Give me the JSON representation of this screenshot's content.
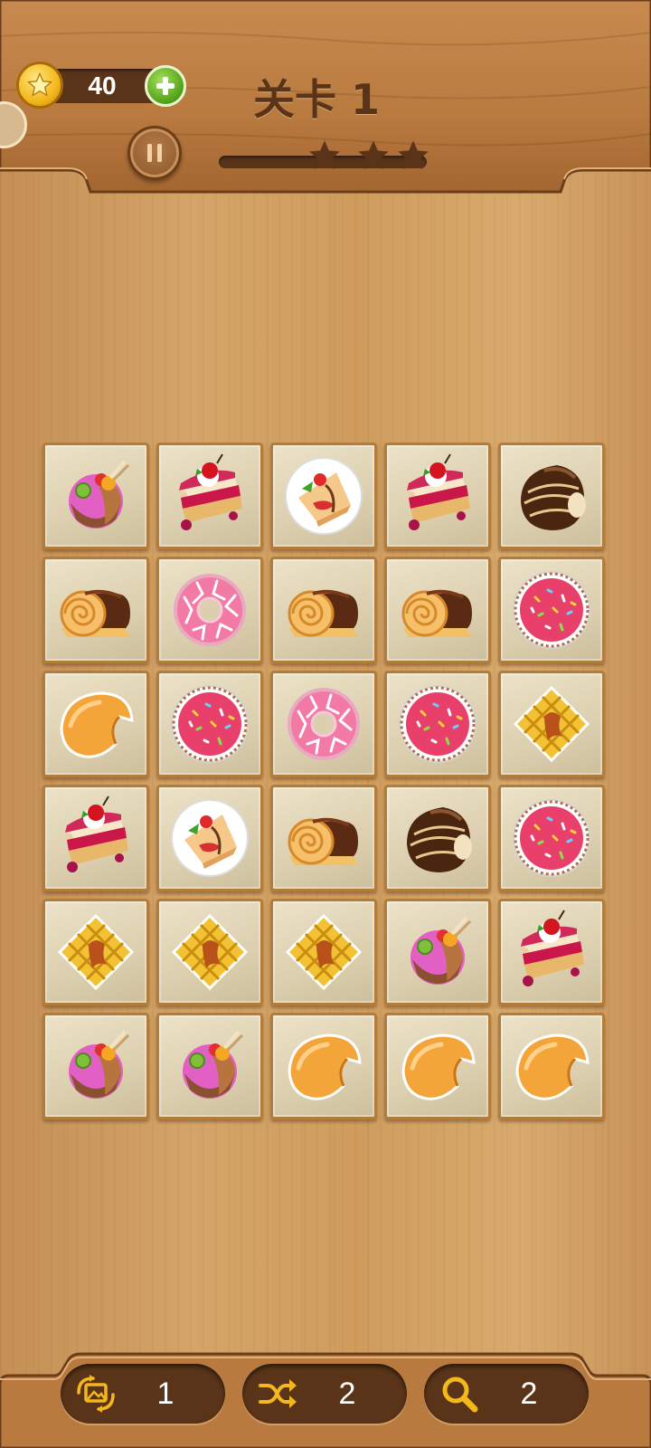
{
  "header": {
    "coins": "40",
    "level_title": "关卡 1",
    "stars_total": 3,
    "stars_earned": 0
  },
  "board": {
    "rows": 6,
    "cols": 5,
    "tiles": [
      [
        "ice-cream-sundae",
        "strawberry-cake-slice",
        "crepe-plate",
        "strawberry-cake-slice",
        "chocolate-truffle"
      ],
      [
        "swiss-roll",
        "pink-donut",
        "swiss-roll",
        "swiss-roll",
        "sprinkle-cupcake"
      ],
      [
        "fortune-cookie",
        "sprinkle-cupcake",
        "pink-donut",
        "sprinkle-cupcake",
        "waffle"
      ],
      [
        "strawberry-cake-slice",
        "crepe-plate",
        "swiss-roll",
        "chocolate-truffle",
        "sprinkle-cupcake"
      ],
      [
        "waffle",
        "waffle",
        "waffle",
        "ice-cream-sundae",
        "strawberry-cake-slice"
      ],
      [
        "ice-cream-sundae",
        "ice-cream-sundae",
        "fortune-cookie",
        "fortune-cookie",
        "fortune-cookie"
      ]
    ]
  },
  "toolbar": {
    "undo": {
      "icon": "undo-image-icon",
      "count": "1"
    },
    "shuffle": {
      "icon": "shuffle-icon",
      "count": "2"
    },
    "hint": {
      "icon": "magnifier-icon",
      "count": "2"
    }
  },
  "colors": {
    "accent": "#f2b81c",
    "pill": "#5a3419",
    "title": "#5a3419",
    "wood": "#d4a468"
  }
}
